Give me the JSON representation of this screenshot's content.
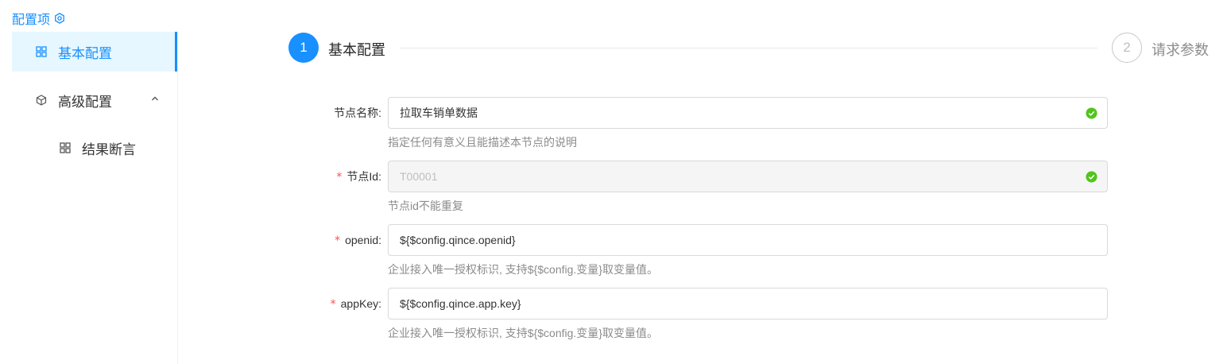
{
  "sidebar": {
    "title": "配置项",
    "title_icon": "settings-icon",
    "items": [
      {
        "label": "基本配置",
        "icon": "grid-icon",
        "active": true
      },
      {
        "label": "高级配置",
        "icon": "cube-icon",
        "expanded": true
      },
      {
        "label": "结果断言",
        "icon": "grid-icon",
        "sub": true
      }
    ]
  },
  "steps": [
    {
      "number": "1",
      "title": "基本配置",
      "status": "active"
    },
    {
      "number": "2",
      "title": "请求参数",
      "status": "wait"
    }
  ],
  "form": {
    "fields": [
      {
        "label": "节点名称:",
        "required": false,
        "value": "拉取车销单数据",
        "help": "指定任何有意义且能描述本节点的说明",
        "validated": true,
        "disabled": false
      },
      {
        "label": "节点Id:",
        "required": true,
        "value": "T00001",
        "help": "节点id不能重复",
        "validated": true,
        "disabled": true
      },
      {
        "label": "openid:",
        "required": true,
        "value": "${$config.qince.openid}",
        "help": "企业接入唯一授权标识, 支持${$config.变量}取变量值。",
        "validated": false,
        "disabled": false
      },
      {
        "label": "appKey:",
        "required": true,
        "value": "${$config.qince.app.key}",
        "help": "企业接入唯一授权标识, 支持${$config.变量}取变量值。",
        "validated": false,
        "disabled": false
      }
    ]
  },
  "colors": {
    "primary": "#1890ff",
    "success": "#52c41a",
    "required": "#ff4d4f"
  }
}
